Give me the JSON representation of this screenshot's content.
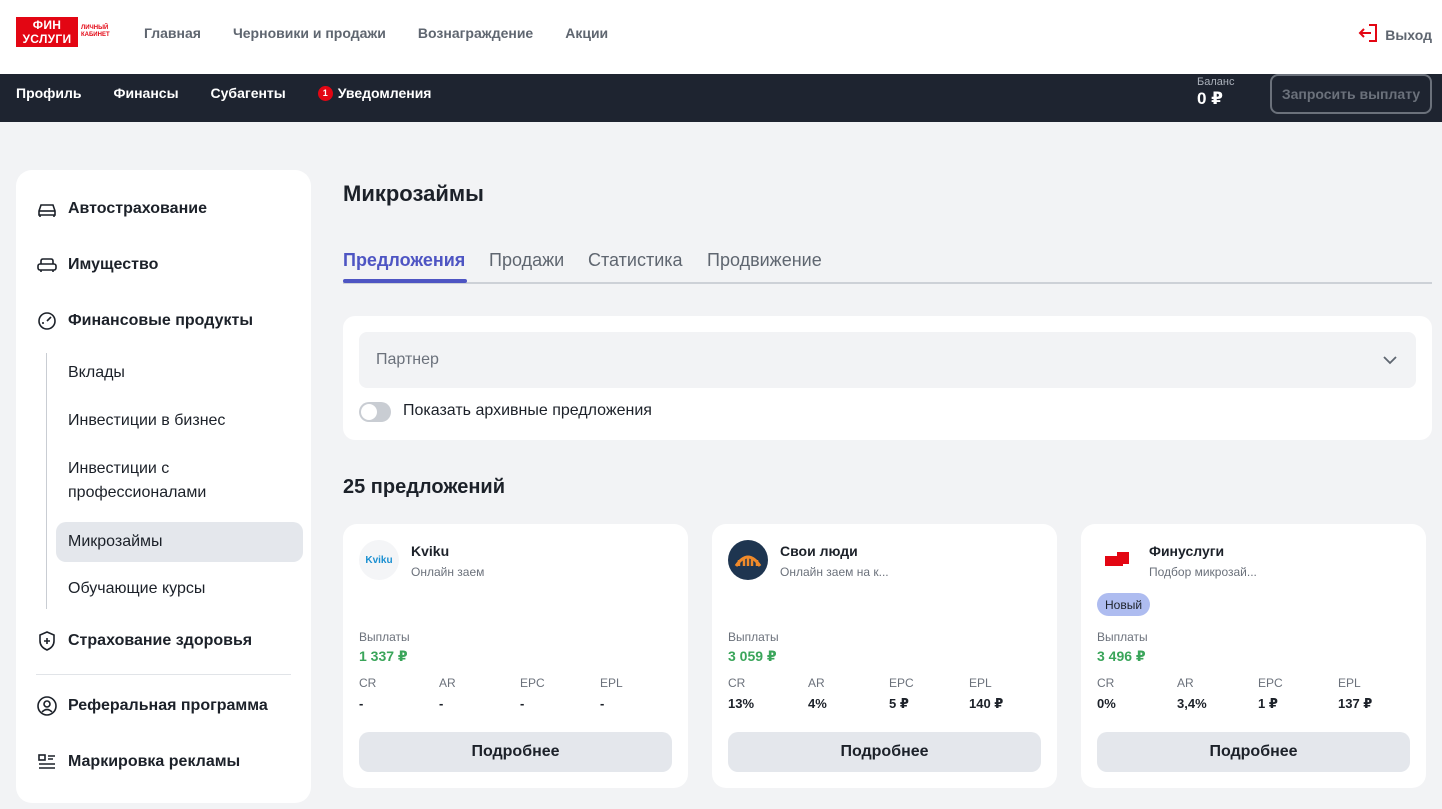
{
  "header": {
    "logo_main": "ФИН УСЛУГИ",
    "logo_sub": "ЛИЧНЫЙ КАБИНЕТ",
    "nav": [
      "Главная",
      "Черновики и продажи",
      "Вознаграждение",
      "Акции"
    ],
    "logout_label": "Выход",
    "logout_icon": "logout-icon"
  },
  "subnav": {
    "items": [
      "Профиль",
      "Финансы",
      "Субагенты"
    ],
    "notifications_label": "Уведомления",
    "notifications_count": "1",
    "balance_label": "Баланс",
    "balance_value": "0 ₽",
    "payout_button": "Запросить выплату"
  },
  "sidebar": {
    "items": [
      {
        "label": "Автострахование",
        "icon": "car-icon"
      },
      {
        "label": "Имущество",
        "icon": "sofa-icon"
      },
      {
        "label": "Финансовые продукты",
        "icon": "gauge-icon"
      },
      {
        "label": "Страхование здоровья",
        "icon": "shield-plus-icon"
      },
      {
        "label": "Реферальная программа",
        "icon": "user-plus-icon"
      },
      {
        "label": "Маркировка рекламы",
        "icon": "list-icon"
      }
    ],
    "subitems": [
      "Вклады",
      "Инвестиции в бизнес",
      "Инвестиции с профессионалами",
      "Микрозаймы",
      "Обучающие курсы"
    ],
    "active_subitem": "Микрозаймы"
  },
  "main": {
    "title": "Микрозаймы",
    "tabs": [
      "Предложения",
      "Продажи",
      "Статистика",
      "Продвижение"
    ],
    "active_tab": "Предложения",
    "filter": {
      "partner_placeholder": "Партнер",
      "archive_toggle_label": "Показать архивные предложения",
      "archive_toggle_on": false
    },
    "offers_count_title": "25 предложений",
    "offers": [
      {
        "name": "Kviku",
        "logo_text": "Kviku",
        "desc": "Онлайн заем",
        "badge": "",
        "payout_label": "Выплаты",
        "payout": "1 337 ₽",
        "metrics": [
          {
            "label": "CR",
            "value": "-"
          },
          {
            "label": "AR",
            "value": "-"
          },
          {
            "label": "EPC",
            "value": "-"
          },
          {
            "label": "EPL",
            "value": "-"
          }
        ],
        "button": "Подробнее"
      },
      {
        "name": "Свои люди",
        "logo_text": "",
        "desc": "Онлайн заем на к...",
        "badge": "",
        "payout_label": "Выплаты",
        "payout": "3 059 ₽",
        "metrics": [
          {
            "label": "CR",
            "value": "13%"
          },
          {
            "label": "AR",
            "value": "4%"
          },
          {
            "label": "EPC",
            "value": "5 ₽"
          },
          {
            "label": "EPL",
            "value": "140 ₽"
          }
        ],
        "button": "Подробнее"
      },
      {
        "name": "Финуслуги",
        "logo_text": "",
        "desc": "Подбор микрозай...",
        "badge": "Новый",
        "payout_label": "Выплаты",
        "payout": "3 496 ₽",
        "metrics": [
          {
            "label": "CR",
            "value": "0%"
          },
          {
            "label": "AR",
            "value": "3,4%"
          },
          {
            "label": "EPC",
            "value": "1 ₽"
          },
          {
            "label": "EPL",
            "value": "137 ₽"
          }
        ],
        "button": "Подробнее"
      }
    ]
  },
  "colors": {
    "brand_red": "#e30613",
    "accent": "#4e55c3",
    "dark_bar": "#1e2430",
    "payout_green": "#3aa55a",
    "badge_blue": "#aebcf0"
  }
}
